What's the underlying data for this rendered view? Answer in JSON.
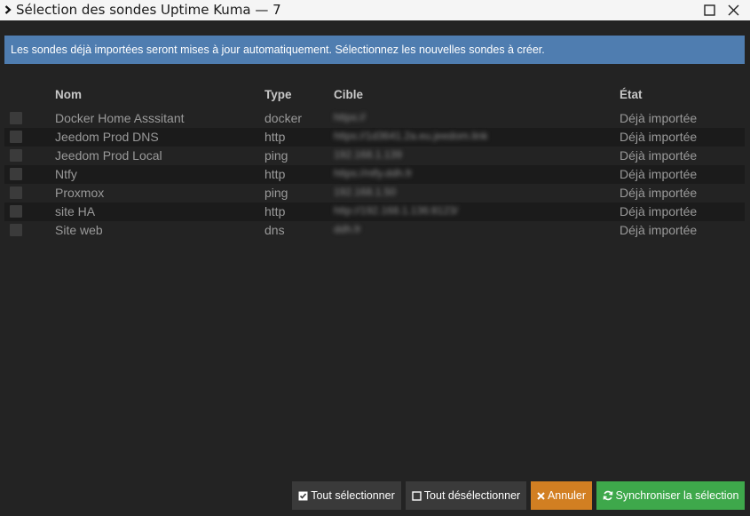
{
  "window": {
    "title": "Sélection des sondes Uptime Kuma — 7"
  },
  "banner": {
    "text": "Les sondes déjà importées seront mises à jour automatiquement. Sélectionnez les nouvelles sondes à créer."
  },
  "table": {
    "columns": {
      "nom": "Nom",
      "type": "Type",
      "cible": "Cible",
      "etat": "État"
    },
    "rows": [
      {
        "nom": "Docker Home Asssitant",
        "type": "docker",
        "cible": "https://",
        "etat": "Déjà importée",
        "checked": false
      },
      {
        "nom": "Jeedom Prod DNS",
        "type": "http",
        "cible": "https://1d3641.2a.eu.jeedom.link",
        "etat": "Déjà importée",
        "checked": false
      },
      {
        "nom": "Jeedom Prod Local",
        "type": "ping",
        "cible": "192.168.1.139",
        "etat": "Déjà importée",
        "checked": false
      },
      {
        "nom": "Ntfy",
        "type": "http",
        "cible": "https://ntfy.ddh.fr",
        "etat": "Déjà importée",
        "checked": false
      },
      {
        "nom": "Proxmox",
        "type": "ping",
        "cible": "192.168.1.50",
        "etat": "Déjà importée",
        "checked": false
      },
      {
        "nom": "site HA",
        "type": "http",
        "cible": "http://192.168.1.136:8123/",
        "etat": "Déjà importée",
        "checked": false
      },
      {
        "nom": "Site web",
        "type": "dns",
        "cible": "ddh.fr",
        "etat": "Déjà importée",
        "checked": false
      }
    ]
  },
  "footer": {
    "select_all": "Tout sélectionner",
    "deselect_all": "Tout désélectionner",
    "cancel": "Annuler",
    "sync": "Synchroniser la sélection"
  },
  "colors": {
    "background": "#232323",
    "banner": "#4f7db0",
    "cancel": "#d27f22",
    "sync": "#3ea84b",
    "neutral_button": "#3a3a3a"
  },
  "icons": {
    "title": "chevron-right-icon",
    "maximize": "maximize-icon",
    "close": "close-icon",
    "select_all": "checkbox-checked-icon",
    "deselect_all": "checkbox-empty-icon",
    "cancel": "times-icon",
    "sync": "refresh-icon"
  }
}
